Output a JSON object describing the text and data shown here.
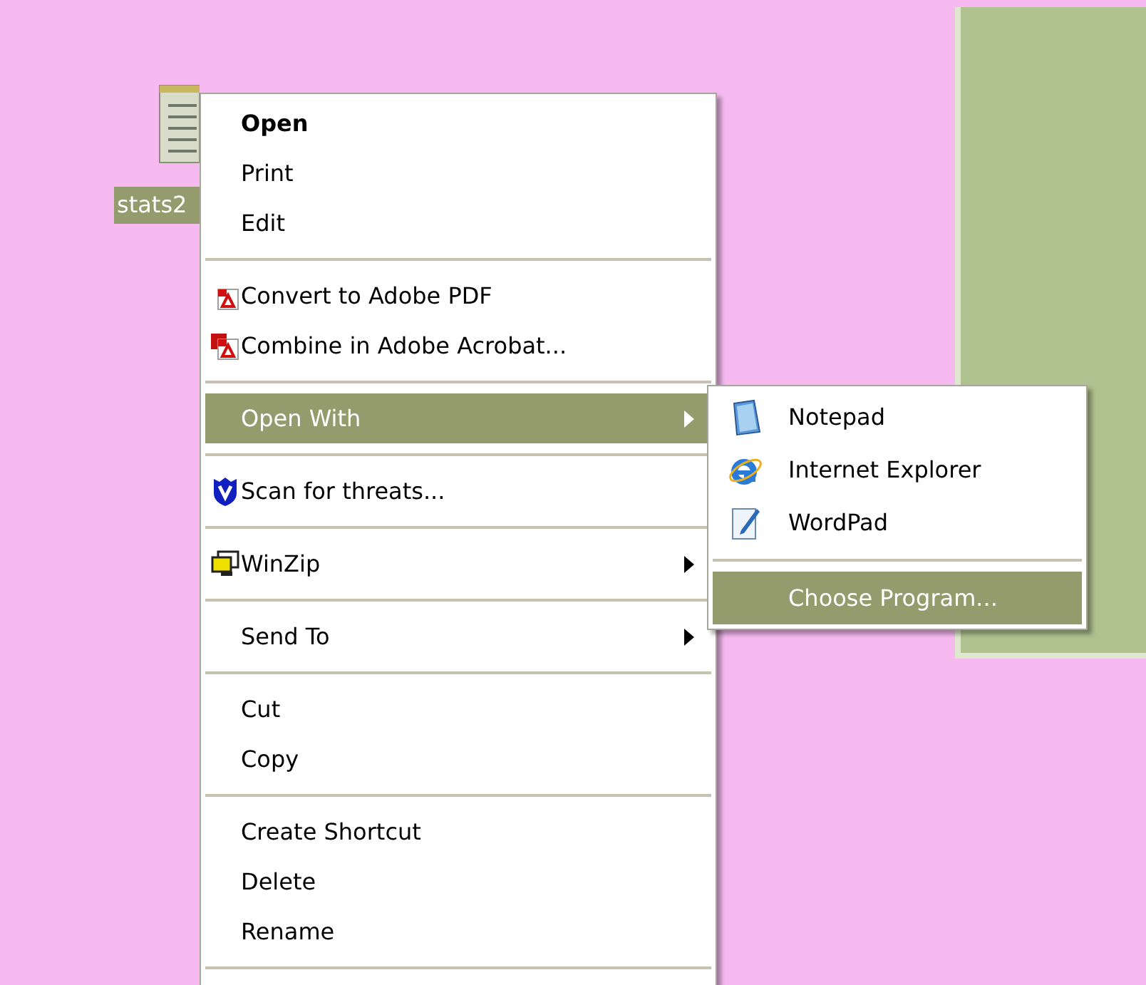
{
  "desktop_icon": {
    "label": "stats2",
    "selected": true
  },
  "context_menu": {
    "items": [
      {
        "kind": "item",
        "label": "Open",
        "default": true,
        "icon": false,
        "has_submenu": false,
        "selected": false
      },
      {
        "kind": "item",
        "label": "Print",
        "default": false,
        "icon": false,
        "has_submenu": false,
        "selected": false
      },
      {
        "kind": "item",
        "label": "Edit",
        "default": false,
        "icon": false,
        "has_submenu": false,
        "selected": false
      },
      {
        "kind": "separator"
      },
      {
        "kind": "item",
        "label": "Convert to Adobe PDF",
        "default": false,
        "icon": true,
        "has_submenu": false,
        "selected": false
      },
      {
        "kind": "item",
        "label": "Combine in Adobe Acrobat...",
        "default": false,
        "icon": true,
        "has_submenu": false,
        "selected": false
      },
      {
        "kind": "separator"
      },
      {
        "kind": "item",
        "label": "Open With",
        "default": false,
        "icon": false,
        "has_submenu": true,
        "selected": true
      },
      {
        "kind": "separator"
      },
      {
        "kind": "item",
        "label": "Scan for threats...",
        "default": false,
        "icon": true,
        "has_submenu": false,
        "selected": false
      },
      {
        "kind": "separator"
      },
      {
        "kind": "item",
        "label": "WinZip",
        "default": false,
        "icon": true,
        "has_submenu": true,
        "selected": false
      },
      {
        "kind": "separator"
      },
      {
        "kind": "item",
        "label": "Send To",
        "default": false,
        "icon": false,
        "has_submenu": true,
        "selected": false
      },
      {
        "kind": "separator"
      },
      {
        "kind": "item",
        "label": "Cut",
        "default": false,
        "icon": false,
        "has_submenu": false,
        "selected": false
      },
      {
        "kind": "item",
        "label": "Copy",
        "default": false,
        "icon": false,
        "has_submenu": false,
        "selected": false
      },
      {
        "kind": "separator"
      },
      {
        "kind": "item",
        "label": "Create Shortcut",
        "default": false,
        "icon": false,
        "has_submenu": false,
        "selected": false
      },
      {
        "kind": "item",
        "label": "Delete",
        "default": false,
        "icon": false,
        "has_submenu": false,
        "selected": false
      },
      {
        "kind": "item",
        "label": "Rename",
        "default": false,
        "icon": false,
        "has_submenu": false,
        "selected": false
      },
      {
        "kind": "separator"
      }
    ]
  },
  "submenu": {
    "items": [
      {
        "kind": "item",
        "label": "Notepad",
        "icon": true,
        "selected": false
      },
      {
        "kind": "item",
        "label": "Internet Explorer",
        "icon": true,
        "selected": false
      },
      {
        "kind": "item",
        "label": "WordPad",
        "icon": true,
        "selected": false
      },
      {
        "kind": "separator"
      },
      {
        "kind": "item",
        "label": "Choose Program...",
        "icon": false,
        "selected": true
      }
    ]
  }
}
